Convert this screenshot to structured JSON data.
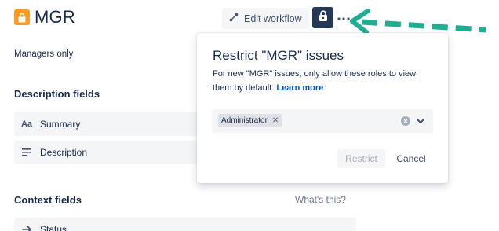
{
  "header": {
    "title": "MGR",
    "edit_workflow_label": "Edit workflow"
  },
  "main": {
    "subtitle": "Managers only",
    "description_section": {
      "heading": "Description fields",
      "fields": [
        {
          "icon": "text-format-icon",
          "icon_glyph": "Aa",
          "label": "Summary"
        },
        {
          "icon": "paragraph-icon",
          "label": "Description"
        }
      ]
    },
    "context_section": {
      "heading": "Context fields",
      "whats_this": "What's this?",
      "fields": [
        {
          "icon": "arrow-right-icon",
          "label": "Status"
        }
      ]
    }
  },
  "popup": {
    "title": "Restrict \"MGR\" issues",
    "description": "For new \"MGR\" issues, only allow these roles to view them by default.",
    "learn_more": "Learn more",
    "selected_roles": [
      "Administrator"
    ],
    "restrict_label": "Restrict",
    "cancel_label": "Cancel"
  },
  "colors": {
    "issue_type": "#ff991f",
    "annotation_arrow": "#1fae94",
    "primary_dark": "#253858",
    "link": "#0052cc"
  }
}
